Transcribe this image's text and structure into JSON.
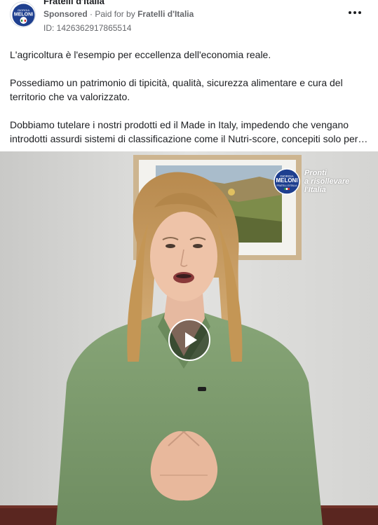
{
  "post": {
    "page_name": "Fratelli d'Italia",
    "sponsored_label": "Sponsored",
    "separator": "·",
    "paid_for_prefix": "Paid for by",
    "payer": "Fratelli d'Italia",
    "ad_id": "ID: 1426362917865514",
    "more_icon": "more-horizontal-icon",
    "avatar_logo": "giorgia-meloni-logo",
    "avatar_lines": [
      "GIORGIA",
      "MELONI",
      "FRATELLI D'ITALIA"
    ]
  },
  "body": {
    "paragraph_1": "L'agricoltura è l'esempio per eccellenza dell'economia reale.",
    "paragraph_2_line_1": "Possediamo un patrimonio di tipicità, qualità, sicurezza alimentare e cura del",
    "paragraph_2_line_2": "territorio che va valorizzato.",
    "paragraph_3_line_1": "Dobbiamo tutelare i nostri prodotti ed il Made in Italy, impedendo che vengano",
    "paragraph_3_line_2": "introdotti assurdi sistemi di classificazione come il Nutri-score, concepiti solo per…"
  },
  "video": {
    "play_icon": "play-icon",
    "watermark_logo_lines": [
      "GIORGIA",
      "MELONI",
      "FRATELLI D'ITALIA"
    ],
    "watermark_text_line_1": "Pronti",
    "watermark_text_line_2": "a risollevare",
    "watermark_text_line_3": "l'Italia",
    "colors": {
      "wall": "#dcdcda",
      "shirt": "#7d9a6c",
      "hair": "#c99a5a",
      "sofa": "#5a2620"
    }
  }
}
